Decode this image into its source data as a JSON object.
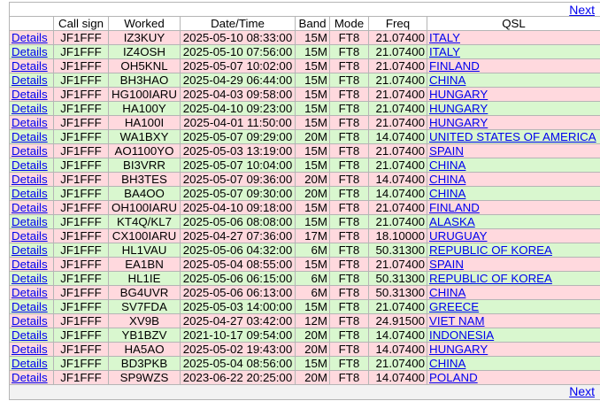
{
  "nav": {
    "next_label": "Next"
  },
  "columns": [
    "",
    "Call sign",
    "Worked",
    "Date/Time",
    "Band",
    "Mode",
    "Freq",
    "QSL"
  ],
  "details_label": "Details",
  "colors": {
    "pink": "#ffd9de",
    "green": "#d9f7cf",
    "link": "#0000ee"
  },
  "rows": [
    {
      "call": "JF1FFF",
      "worked": "IZ3KUY",
      "dt": "2025-05-10 08:33:00",
      "band": "15M",
      "mode": "FT8",
      "freq": "21.07400",
      "qsl": "ITALY",
      "color": "pink"
    },
    {
      "call": "JF1FFF",
      "worked": "IZ4OSH",
      "dt": "2025-05-10 07:56:00",
      "band": "15M",
      "mode": "FT8",
      "freq": "21.07400",
      "qsl": "ITALY",
      "color": "green"
    },
    {
      "call": "JF1FFF",
      "worked": "OH5KNL",
      "dt": "2025-05-07 10:02:00",
      "band": "15M",
      "mode": "FT8",
      "freq": "21.07400",
      "qsl": "FINLAND",
      "color": "pink"
    },
    {
      "call": "JF1FFF",
      "worked": "BH3HAO",
      "dt": "2025-04-29 06:44:00",
      "band": "15M",
      "mode": "FT8",
      "freq": "21.07400",
      "qsl": "CHINA",
      "color": "green"
    },
    {
      "call": "JF1FFF",
      "worked": "HG100IARU",
      "dt": "2025-04-03 09:58:00",
      "band": "15M",
      "mode": "FT8",
      "freq": "21.07400",
      "qsl": "HUNGARY",
      "color": "pink"
    },
    {
      "call": "JF1FFF",
      "worked": "HA100Y",
      "dt": "2025-04-10 09:23:00",
      "band": "15M",
      "mode": "FT8",
      "freq": "21.07400",
      "qsl": "HUNGARY",
      "color": "green"
    },
    {
      "call": "JF1FFF",
      "worked": "HA100I",
      "dt": "2025-04-01 11:50:00",
      "band": "15M",
      "mode": "FT8",
      "freq": "21.07400",
      "qsl": "HUNGARY",
      "color": "pink"
    },
    {
      "call": "JF1FFF",
      "worked": "WA1BXY",
      "dt": "2025-05-07 09:29:00",
      "band": "20M",
      "mode": "FT8",
      "freq": "14.07400",
      "qsl": "UNITED STATES OF AMERICA",
      "color": "green"
    },
    {
      "call": "JF1FFF",
      "worked": "AO1100YO",
      "dt": "2025-05-03 13:19:00",
      "band": "15M",
      "mode": "FT8",
      "freq": "21.07400",
      "qsl": "SPAIN",
      "color": "pink"
    },
    {
      "call": "JF1FFF",
      "worked": "BI3VRR",
      "dt": "2025-05-07 10:04:00",
      "band": "15M",
      "mode": "FT8",
      "freq": "21.07400",
      "qsl": "CHINA",
      "color": "green"
    },
    {
      "call": "JF1FFF",
      "worked": "BH3TES",
      "dt": "2025-05-07 09:36:00",
      "band": "20M",
      "mode": "FT8",
      "freq": "14.07400",
      "qsl": "CHINA",
      "color": "pink"
    },
    {
      "call": "JF1FFF",
      "worked": "BA4OO",
      "dt": "2025-05-07 09:30:00",
      "band": "20M",
      "mode": "FT8",
      "freq": "14.07400",
      "qsl": "CHINA",
      "color": "green"
    },
    {
      "call": "JF1FFF",
      "worked": "OH100IARU",
      "dt": "2025-04-10 09:18:00",
      "band": "15M",
      "mode": "FT8",
      "freq": "21.07400",
      "qsl": "FINLAND",
      "color": "pink"
    },
    {
      "call": "JF1FFF",
      "worked": "KT4Q/KL7",
      "dt": "2025-05-06 08:08:00",
      "band": "15M",
      "mode": "FT8",
      "freq": "21.07400",
      "qsl": "ALASKA",
      "color": "green"
    },
    {
      "call": "JF1FFF",
      "worked": "CX100IARU",
      "dt": "2025-04-27 07:36:00",
      "band": "17M",
      "mode": "FT8",
      "freq": "18.10000",
      "qsl": "URUGUAY",
      "color": "pink"
    },
    {
      "call": "JF1FFF",
      "worked": "HL1VAU",
      "dt": "2025-05-06 04:32:00",
      "band": "6M",
      "mode": "FT8",
      "freq": "50.31300",
      "qsl": "REPUBLIC OF KOREA",
      "color": "green"
    },
    {
      "call": "JF1FFF",
      "worked": "EA1BN",
      "dt": "2025-05-04 08:55:00",
      "band": "15M",
      "mode": "FT8",
      "freq": "21.07400",
      "qsl": "SPAIN",
      "color": "pink"
    },
    {
      "call": "JF1FFF",
      "worked": "HL1IE",
      "dt": "2025-05-06 06:15:00",
      "band": "6M",
      "mode": "FT8",
      "freq": "50.31300",
      "qsl": "REPUBLIC OF KOREA",
      "color": "green"
    },
    {
      "call": "JF1FFF",
      "worked": "BG4UVR",
      "dt": "2025-05-06 06:13:00",
      "band": "6M",
      "mode": "FT8",
      "freq": "50.31300",
      "qsl": "CHINA",
      "color": "pink"
    },
    {
      "call": "JF1FFF",
      "worked": "SV7FDA",
      "dt": "2025-05-03 14:00:00",
      "band": "15M",
      "mode": "FT8",
      "freq": "21.07400",
      "qsl": "GREECE",
      "color": "green"
    },
    {
      "call": "JF1FFF",
      "worked": "XV9B",
      "dt": "2025-04-27 03:42:00",
      "band": "12M",
      "mode": "FT8",
      "freq": "24.91500",
      "qsl": "VIET NAM",
      "color": "pink"
    },
    {
      "call": "JF1FFF",
      "worked": "YB1BZV",
      "dt": "2021-10-17 09:54:00",
      "band": "20M",
      "mode": "FT8",
      "freq": "14.07400",
      "qsl": "INDONESIA",
      "color": "green"
    },
    {
      "call": "JF1FFF",
      "worked": "HA5AO",
      "dt": "2025-05-02 19:43:00",
      "band": "20M",
      "mode": "FT8",
      "freq": "14.07400",
      "qsl": "HUNGARY",
      "color": "pink"
    },
    {
      "call": "JF1FFF",
      "worked": "BD3PKB",
      "dt": "2025-05-04 08:56:00",
      "band": "15M",
      "mode": "FT8",
      "freq": "21.07400",
      "qsl": "CHINA",
      "color": "green"
    },
    {
      "call": "JF1FFF",
      "worked": "SP9WZS",
      "dt": "2023-06-22 20:25:00",
      "band": "20M",
      "mode": "FT8",
      "freq": "14.07400",
      "qsl": "POLAND",
      "color": "pink"
    }
  ]
}
